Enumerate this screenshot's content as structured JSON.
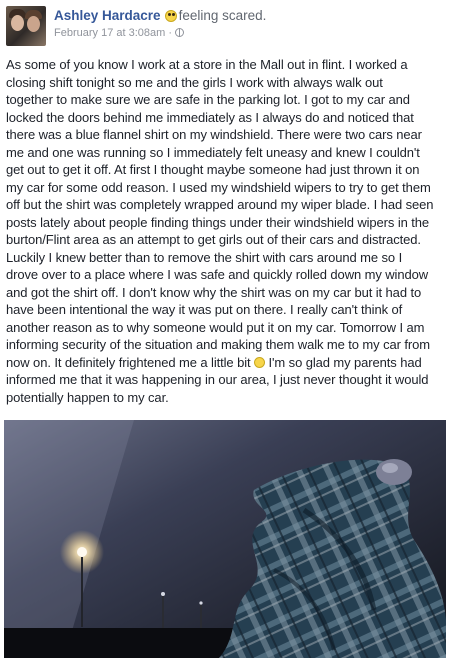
{
  "post": {
    "author": "Ashley Hardacre",
    "feeling_icon": "scared-emoji-icon",
    "feeling": "feeling scared.",
    "timestamp": "February 17 at 3:08am ·",
    "privacy_icon": "globe-icon",
    "body_lines": [
      "As some of you know I work at a store in the Mall out in flint. I worked a",
      "closing shift tonight so me and the girls I work with always walk out",
      "together to make sure we are safe in the parking lot. I got to my car and",
      "locked the doors behind me immediately as I always do and noticed that",
      "there was a blue flannel shirt on my windshield. There were two cars near",
      "me and one was running so I immediately felt uneasy and knew I couldn't",
      "get out to get it off. At first I thought maybe someone had just thrown it on",
      "my car for some odd reason. I used my windshield wipers to try to get them",
      "off but the shirt was completely wrapped around my wiper blade. I had seen",
      "posts lately about people finding things under their windshield wipers in the",
      "burton/Flint area as an attempt to get girls out of their cars and distracted.",
      "Luckily I knew better than to remove the shirt with cars around me so I",
      "drove over to a place where I was safe and quickly rolled down my window",
      "and got the shirt off. I don't know why the shirt was on my car but it had to",
      "have been intentional the way it was put on there. I really can't think of",
      "another reason as to why someone would put it on my car. Tomorrow I am",
      "informing security of the situation and making them walk me to my car from",
      "now on. It definitely frightened me a little bit",
      "informed me that it was happening in our area, I just never thought it would",
      "potentially happen to my car."
    ],
    "inline_emoji_icon": "worried-emoji-icon",
    "line18_after": " I'm so glad my parents had",
    "photo_description_icon": "windshield-flannel-photo"
  }
}
